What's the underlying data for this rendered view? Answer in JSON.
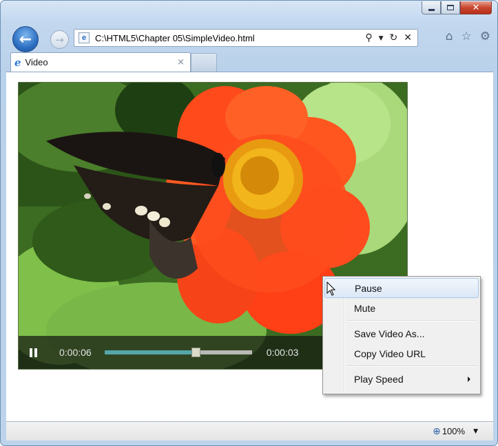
{
  "browser": {
    "address": "C:\\HTML5\\Chapter 05\\SimpleVideo.html",
    "back_icon": "back-arrow-icon",
    "forward_icon": "forward-arrow-icon",
    "address_tools": [
      "search-icon",
      "dropdown-icon",
      "refresh-icon",
      "stop-icon"
    ],
    "toolbar_icons": [
      "home-icon",
      "favorites-icon",
      "tools-gear-icon"
    ]
  },
  "tab": {
    "label": "Video",
    "close_label": "×"
  },
  "video": {
    "current_time": "0:00:06",
    "remaining_time": "0:00:03",
    "progress": 0.62,
    "state": "playing"
  },
  "context_menu": {
    "items": [
      {
        "label": "Pause"
      },
      {
        "label": "Mute"
      },
      {
        "label": "Save Video As..."
      },
      {
        "label": "Copy Video URL"
      },
      {
        "label": "Play Speed"
      }
    ]
  },
  "status": {
    "zoom": "100%"
  },
  "colors": {
    "accent": "#2d6fc2",
    "seek_fill": "#55a6aa",
    "menu_highlight": "#dbe8f6"
  }
}
